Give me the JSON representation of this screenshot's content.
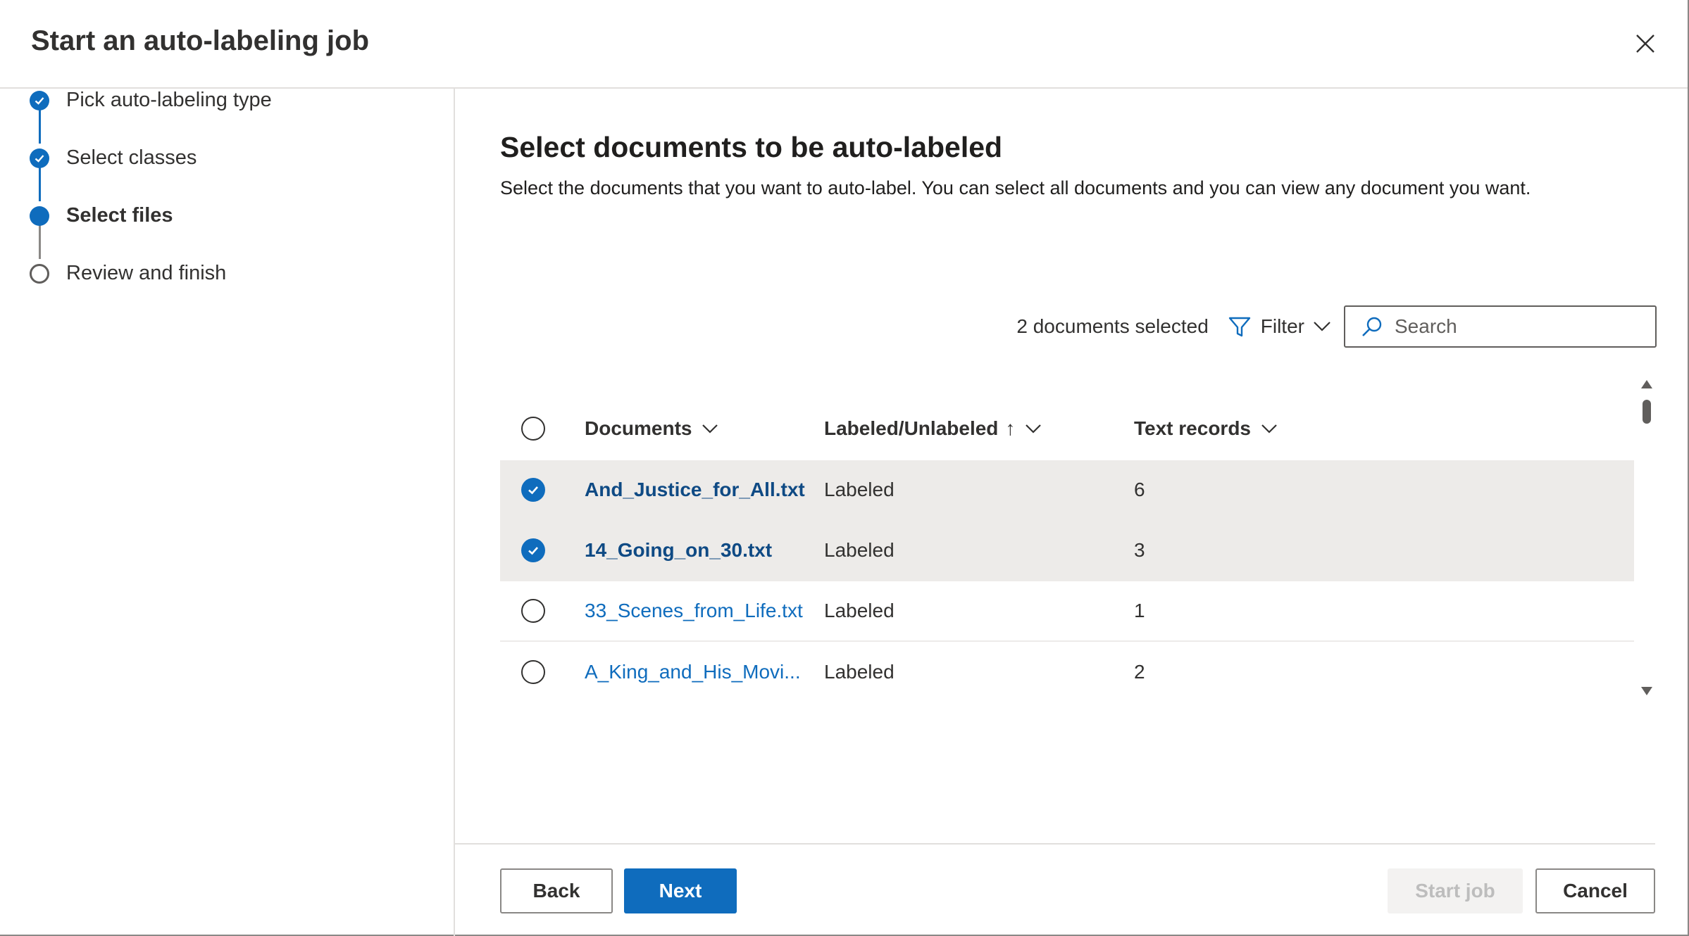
{
  "dialog": {
    "title": "Start an auto-labeling job"
  },
  "steps": [
    {
      "label": "Pick auto-labeling type",
      "state": "done"
    },
    {
      "label": "Select classes",
      "state": "done"
    },
    {
      "label": "Select files",
      "state": "current"
    },
    {
      "label": "Review and finish",
      "state": "pending"
    }
  ],
  "main": {
    "title": "Select documents to be auto-labeled",
    "description": "Select the documents that you want to auto-label. You can select all documents and you can view any document you want."
  },
  "toolbar": {
    "selected_count": "2 documents selected",
    "filter_label": "Filter",
    "search_placeholder": "Search"
  },
  "table": {
    "columns": {
      "documents": "Documents",
      "labeled": "Labeled/Unlabeled",
      "text_records": "Text records"
    },
    "rows": [
      {
        "document": "And_Justice_for_All.txt",
        "status": "Labeled",
        "records": "6",
        "selected": true
      },
      {
        "document": "14_Going_on_30.txt",
        "status": "Labeled",
        "records": "3",
        "selected": true
      },
      {
        "document": "33_Scenes_from_Life.txt",
        "status": "Labeled",
        "records": "1",
        "selected": false
      },
      {
        "document": "A_King_and_His_Movi...",
        "status": "Labeled",
        "records": "2",
        "selected": false
      }
    ]
  },
  "footer": {
    "back_label": "Back",
    "next_label": "Next",
    "start_label": "Start job",
    "cancel_label": "Cancel"
  },
  "colors": {
    "accent": "#0f6cbd",
    "selected_row": "#edebe9",
    "disabled_text": "#bdbdbd"
  }
}
